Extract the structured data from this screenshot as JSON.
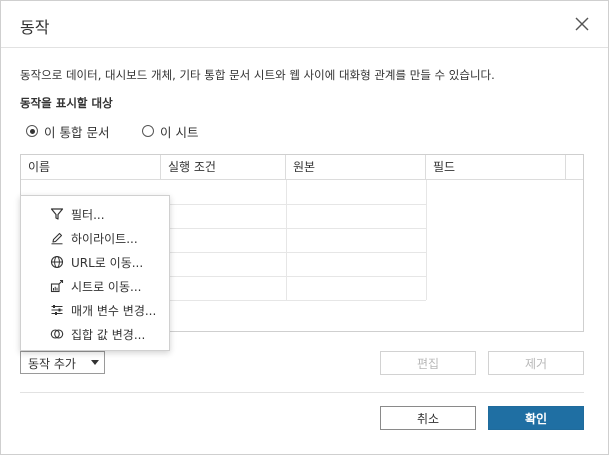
{
  "dialog": {
    "title": "동작",
    "description": "동작으로 데이터, 대시보드 개체, 기타 통합 문서 시트와 웹 사이에 대화형 관계를 만들 수 있습니다.",
    "section_label": "동작을 표시할 대상"
  },
  "scope": {
    "options": [
      {
        "label": "이 통합 문서",
        "selected": true
      },
      {
        "label": "이 시트",
        "selected": false
      }
    ]
  },
  "table": {
    "columns": [
      "이름",
      "실행 조건",
      "원본",
      "필드"
    ],
    "rows": []
  },
  "add_menu": {
    "items": [
      {
        "label": "필터...",
        "icon": "filter-icon"
      },
      {
        "label": "하이라이트...",
        "icon": "highlight-pen-icon"
      },
      {
        "label": "URL로 이동...",
        "icon": "globe-icon"
      },
      {
        "label": "시트로 이동...",
        "icon": "go-to-sheet-icon"
      },
      {
        "label": "매개 변수 변경...",
        "icon": "parameter-icon"
      },
      {
        "label": "집합 값 변경...",
        "icon": "set-icon"
      }
    ]
  },
  "buttons": {
    "add_action": "동작 추가",
    "edit": "편집",
    "remove": "제거",
    "cancel": "취소",
    "ok": "확인"
  },
  "colors": {
    "primary": "#1f6fa3",
    "disabled_text": "#b8b8b8",
    "border": "#cfcfcf"
  }
}
